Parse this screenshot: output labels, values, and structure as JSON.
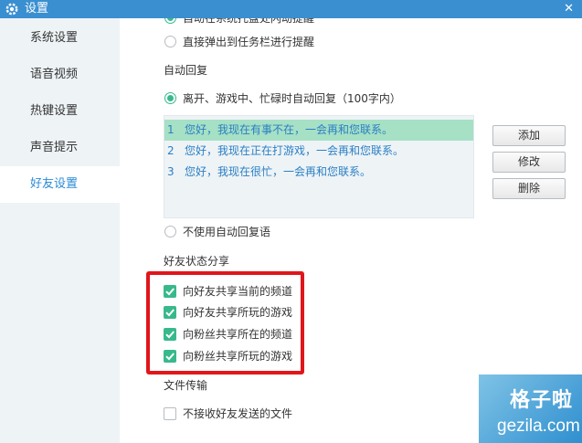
{
  "window": {
    "title": "设置",
    "close_glyph": "✕"
  },
  "sidebar": {
    "items": [
      {
        "label": "系统设置",
        "active": false
      },
      {
        "label": "语音视频",
        "active": false
      },
      {
        "label": "热键设置",
        "active": false
      },
      {
        "label": "声音提示",
        "active": false
      },
      {
        "label": "好友设置",
        "active": true
      }
    ]
  },
  "notify": {
    "option_cutoff": "自动在系统托盘处闪动提醒",
    "option_taskbar": "直接弹出到任务栏进行提醒"
  },
  "auto_reply": {
    "section_title": "自动回复",
    "enable_label": "离开、游戏中、忙碌时自动回复（100字内）",
    "messages": [
      {
        "num": "1",
        "text": "您好，我现在有事不在，一会再和您联系。",
        "selected": true
      },
      {
        "num": "2",
        "text": "您好，我现在正在打游戏，一会再和您联系。",
        "selected": false
      },
      {
        "num": "3",
        "text": "您好，我现在很忙，一会再和您联系。",
        "selected": false
      }
    ],
    "buttons": {
      "add": "添加",
      "edit": "修改",
      "delete": "删除"
    },
    "disable_label": "不使用自动回复语"
  },
  "status_share": {
    "section_title": "好友状态分享",
    "options": [
      {
        "label": "向好友共享当前的频道",
        "checked": true
      },
      {
        "label": "向好友共享所玩的游戏",
        "checked": true
      },
      {
        "label": "向粉丝共享所在的频道",
        "checked": true
      },
      {
        "label": "向粉丝共享所玩的游戏",
        "checked": true
      }
    ]
  },
  "file_transfer": {
    "section_title": "文件传输",
    "reject_label": "不接收好友发送的文件",
    "reject_checked": false
  },
  "watermark": {
    "name": "格子啦",
    "domain": "gezila.com"
  },
  "colors": {
    "titlebar": "#3a8fd0",
    "sidebar_bg": "#eef3f6",
    "active_nav_text": "#2a8bd6",
    "check_green": "#38b98c",
    "selected_row": "#a6e0c5",
    "highlight_red": "#e0161b"
  },
  "icons": {
    "title": "gear-icon",
    "close": "close-icon",
    "check": "check-icon"
  }
}
